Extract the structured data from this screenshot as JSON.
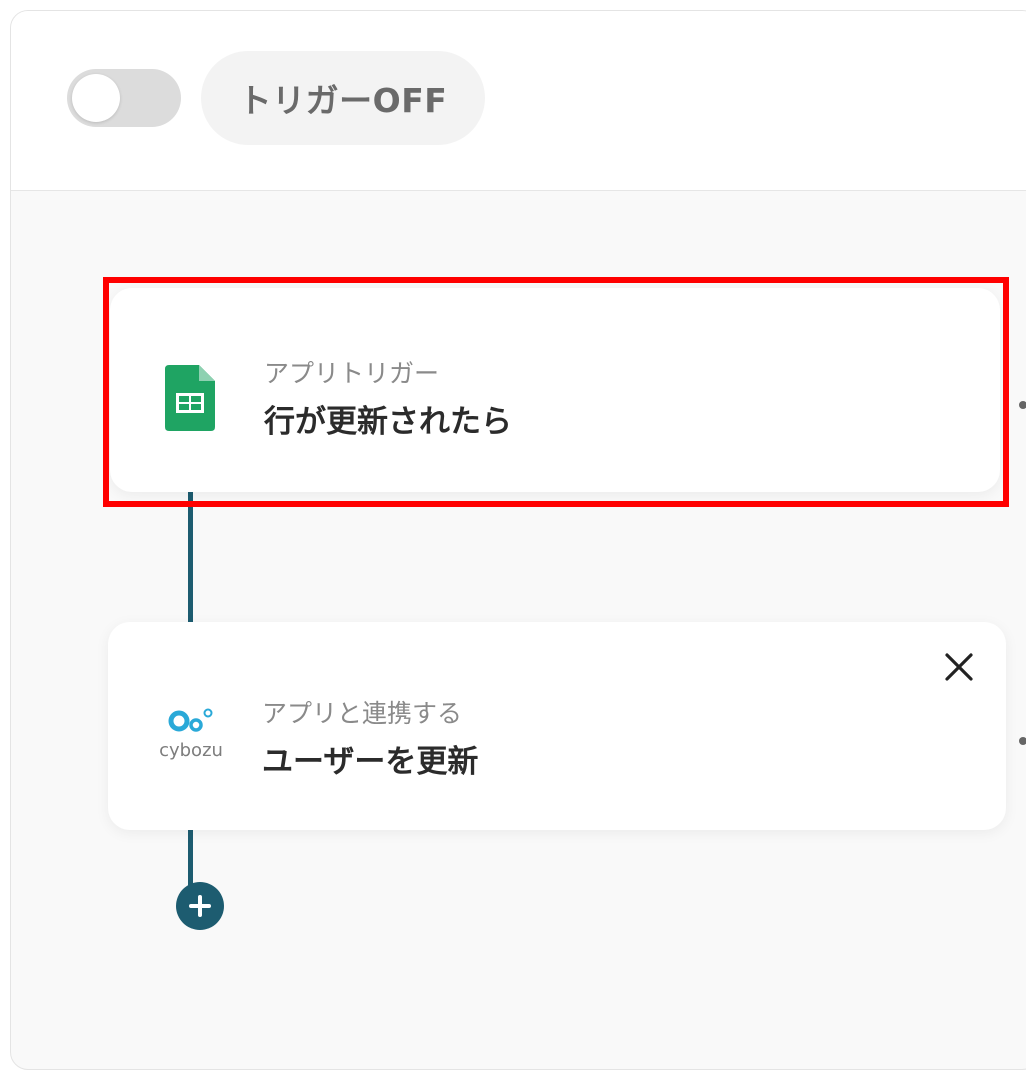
{
  "header": {
    "trigger_toggle_state": "off",
    "trigger_status_label": "トリガーOFF"
  },
  "flow": {
    "steps": [
      {
        "subtitle": "アプリトリガー",
        "title": "行が更新されたら",
        "icon": "google-sheets-icon",
        "highlighted": true
      },
      {
        "subtitle": "アプリと連携する",
        "title": "ユーザーを更新",
        "icon": "cybozu-icon",
        "icon_label": "cybozu"
      }
    ]
  },
  "colors": {
    "connector": "#1d5c70",
    "highlight_border": "#ff0000",
    "sheets_green": "#1fa463",
    "cybozu_blue": "#2aa9d8"
  }
}
